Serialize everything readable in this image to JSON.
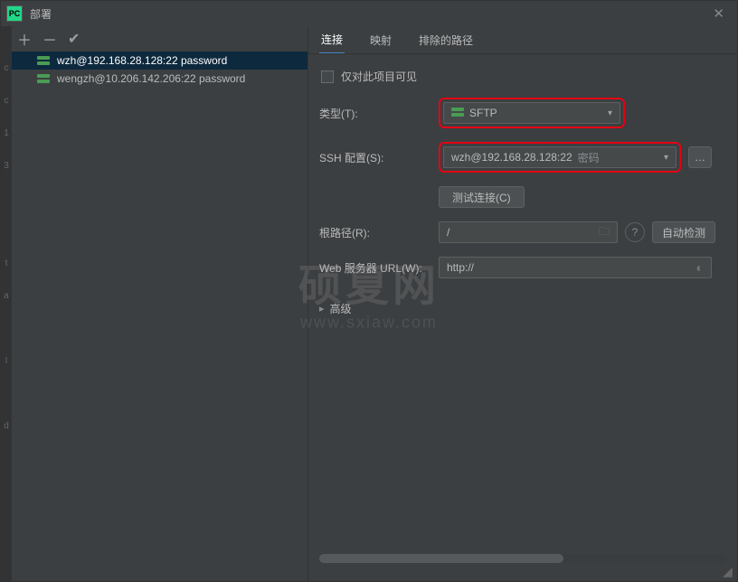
{
  "window": {
    "title": "部署"
  },
  "sidebar": {
    "items": [
      {
        "label": "wzh@192.168.28.128:22 password"
      },
      {
        "label": "wengzh@10.206.142.206:22 password"
      }
    ],
    "selected_index": 0
  },
  "tabs": {
    "connection": "连接",
    "mapping": "映射",
    "excluded": "排除的路径",
    "active": "connection"
  },
  "form": {
    "visible_only_label": "仅对此项目可见",
    "visible_only_checked": false,
    "type_label": "类型(T):",
    "type_value": "SFTP",
    "ssh_label": "SSH 配置(S):",
    "ssh_value": "wzh@192.168.28.128:22",
    "ssh_suffix": "密码",
    "test_button": "测试连接(C)",
    "root_label": "根路径(R):",
    "root_value": "/",
    "auto_detect": "自动检测",
    "web_label": "Web 服务器 URL(W):",
    "web_value": "http://",
    "advanced_label": "高级"
  },
  "watermark": {
    "text": "硕夏网",
    "url": "www.sxiaw.com"
  }
}
